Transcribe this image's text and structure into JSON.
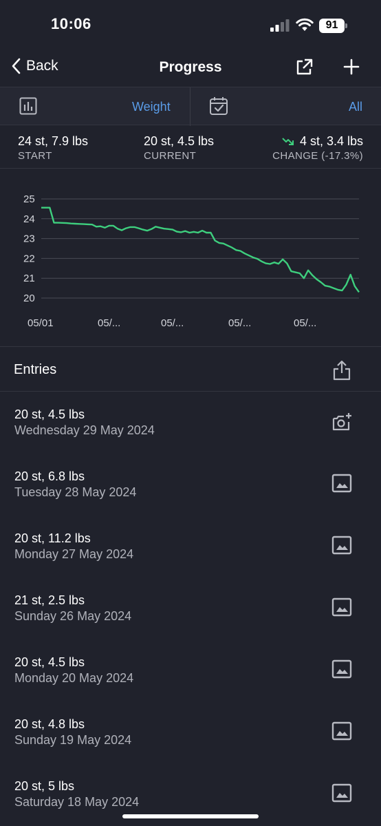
{
  "status": {
    "time": "10:06",
    "battery": "91"
  },
  "nav": {
    "back_label": "Back",
    "title": "Progress"
  },
  "filters": {
    "metric": "Weight",
    "range": "All"
  },
  "stats": {
    "start_value": "24 st, 7.9 lbs",
    "start_label": "START",
    "current_value": "20 st, 4.5 lbs",
    "current_label": "CURRENT",
    "change_value": "4 st, 3.4 lbs",
    "change_label": "CHANGE (-17.3%)"
  },
  "chart_data": {
    "type": "line",
    "color": "#3ecf7e",
    "y_ticks": [
      "25",
      "24",
      "23",
      "22",
      "21",
      "20"
    ],
    "ylim": [
      20,
      25
    ],
    "x_tick_labels": [
      "05/01",
      "05/...",
      "05/...",
      "05/...",
      "05/..."
    ],
    "series": [
      {
        "values": [
          24.56,
          24.56,
          24.56,
          23.8,
          23.8,
          23.79,
          23.78,
          23.76,
          23.75,
          23.74,
          23.73,
          23.72,
          23.71,
          23.6,
          23.62,
          23.55,
          23.65,
          23.65,
          23.5,
          23.42,
          23.52,
          23.58,
          23.58,
          23.52,
          23.45,
          23.4,
          23.48,
          23.6,
          23.55,
          23.5,
          23.48,
          23.45,
          23.35,
          23.32,
          23.38,
          23.3,
          23.34,
          23.3,
          23.4,
          23.3,
          23.3,
          22.9,
          22.78,
          22.75,
          22.65,
          22.55,
          22.42,
          22.38,
          22.25,
          22.15,
          22.05,
          21.98,
          21.85,
          21.75,
          21.72,
          21.8,
          21.73,
          21.95,
          21.75,
          21.35,
          21.3,
          21.25,
          21.0,
          21.4,
          21.15,
          20.95,
          20.8,
          20.62,
          20.58,
          20.5,
          20.42,
          20.38,
          20.68,
          21.18,
          20.6,
          20.3
        ]
      }
    ]
  },
  "entries_title": "Entries",
  "entries": [
    {
      "weight": "20 st, 4.5 lbs",
      "date": "Wednesday 29 May 2024",
      "icon": "add-photo-icon"
    },
    {
      "weight": "20 st, 6.8 lbs",
      "date": "Tuesday 28 May 2024",
      "icon": "photo-icon"
    },
    {
      "weight": "20 st, 11.2 lbs",
      "date": "Monday 27 May 2024",
      "icon": "photo-icon"
    },
    {
      "weight": "21 st, 2.5 lbs",
      "date": "Sunday 26 May 2024",
      "icon": "photo-icon"
    },
    {
      "weight": "20 st, 4.5 lbs",
      "date": "Monday 20 May 2024",
      "icon": "photo-icon"
    },
    {
      "weight": "20 st, 4.8 lbs",
      "date": "Sunday 19 May 2024",
      "icon": "photo-icon"
    },
    {
      "weight": "20 st, 5 lbs",
      "date": "Saturday 18 May 2024",
      "icon": "photo-icon"
    }
  ]
}
